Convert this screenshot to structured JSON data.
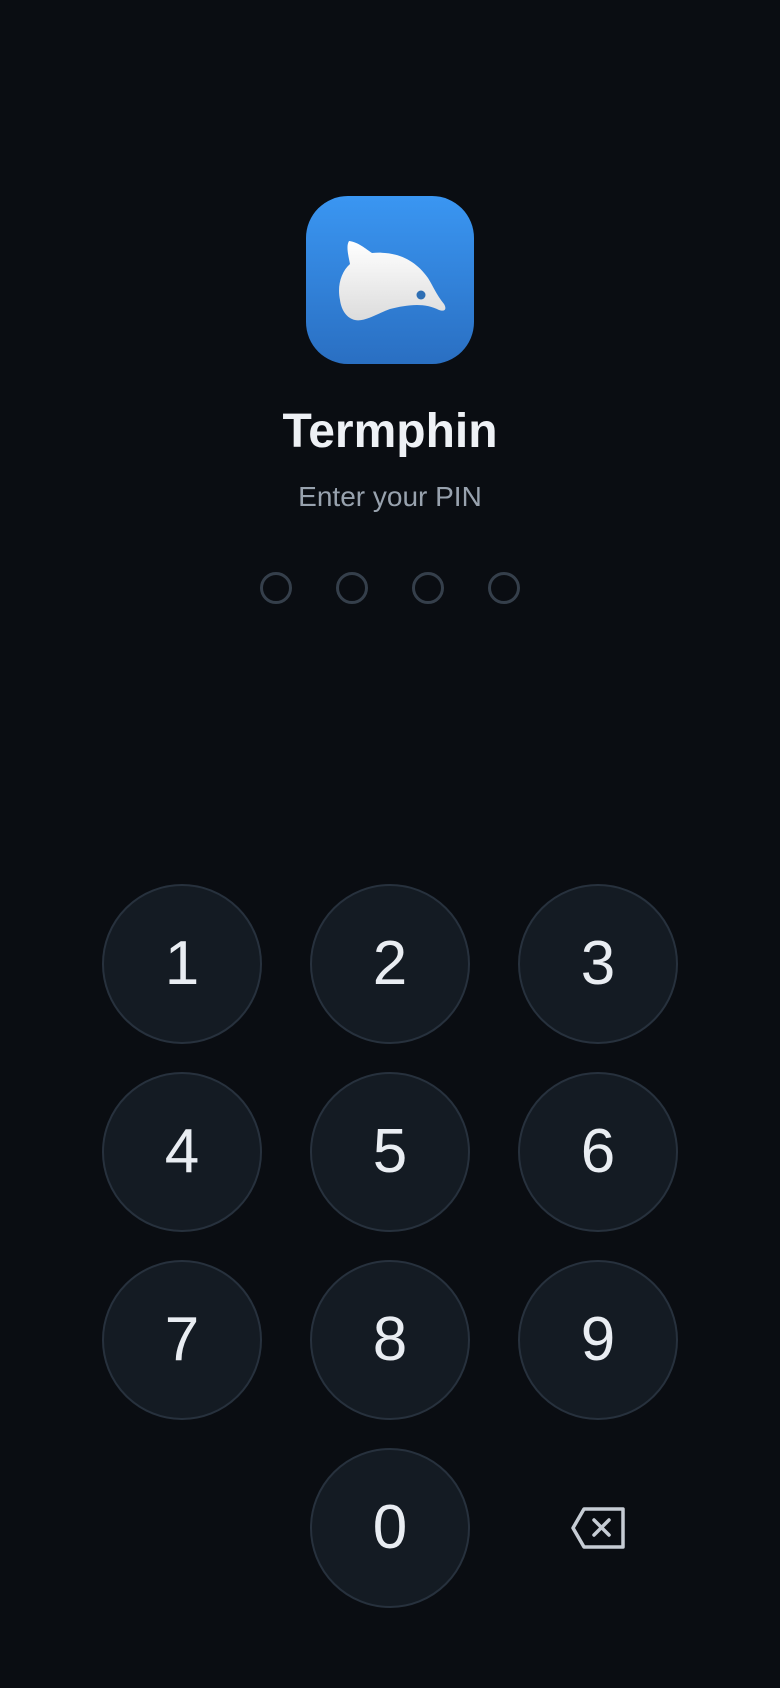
{
  "app": {
    "name": "Termphin",
    "icon": "dolphin-icon",
    "icon_gradient": [
      "#3a96f2",
      "#2a6fc2"
    ]
  },
  "prompt": "Enter your PIN",
  "pin": {
    "length": 4,
    "entered": 0
  },
  "keypad": {
    "keys": [
      "1",
      "2",
      "3",
      "4",
      "5",
      "6",
      "7",
      "8",
      "9",
      "0"
    ],
    "backspace_icon": "backspace-icon"
  },
  "colors": {
    "background": "#0a0d12",
    "key_fill": "#141b23",
    "key_border": "#27313d",
    "dot_border": "#353f4b"
  }
}
